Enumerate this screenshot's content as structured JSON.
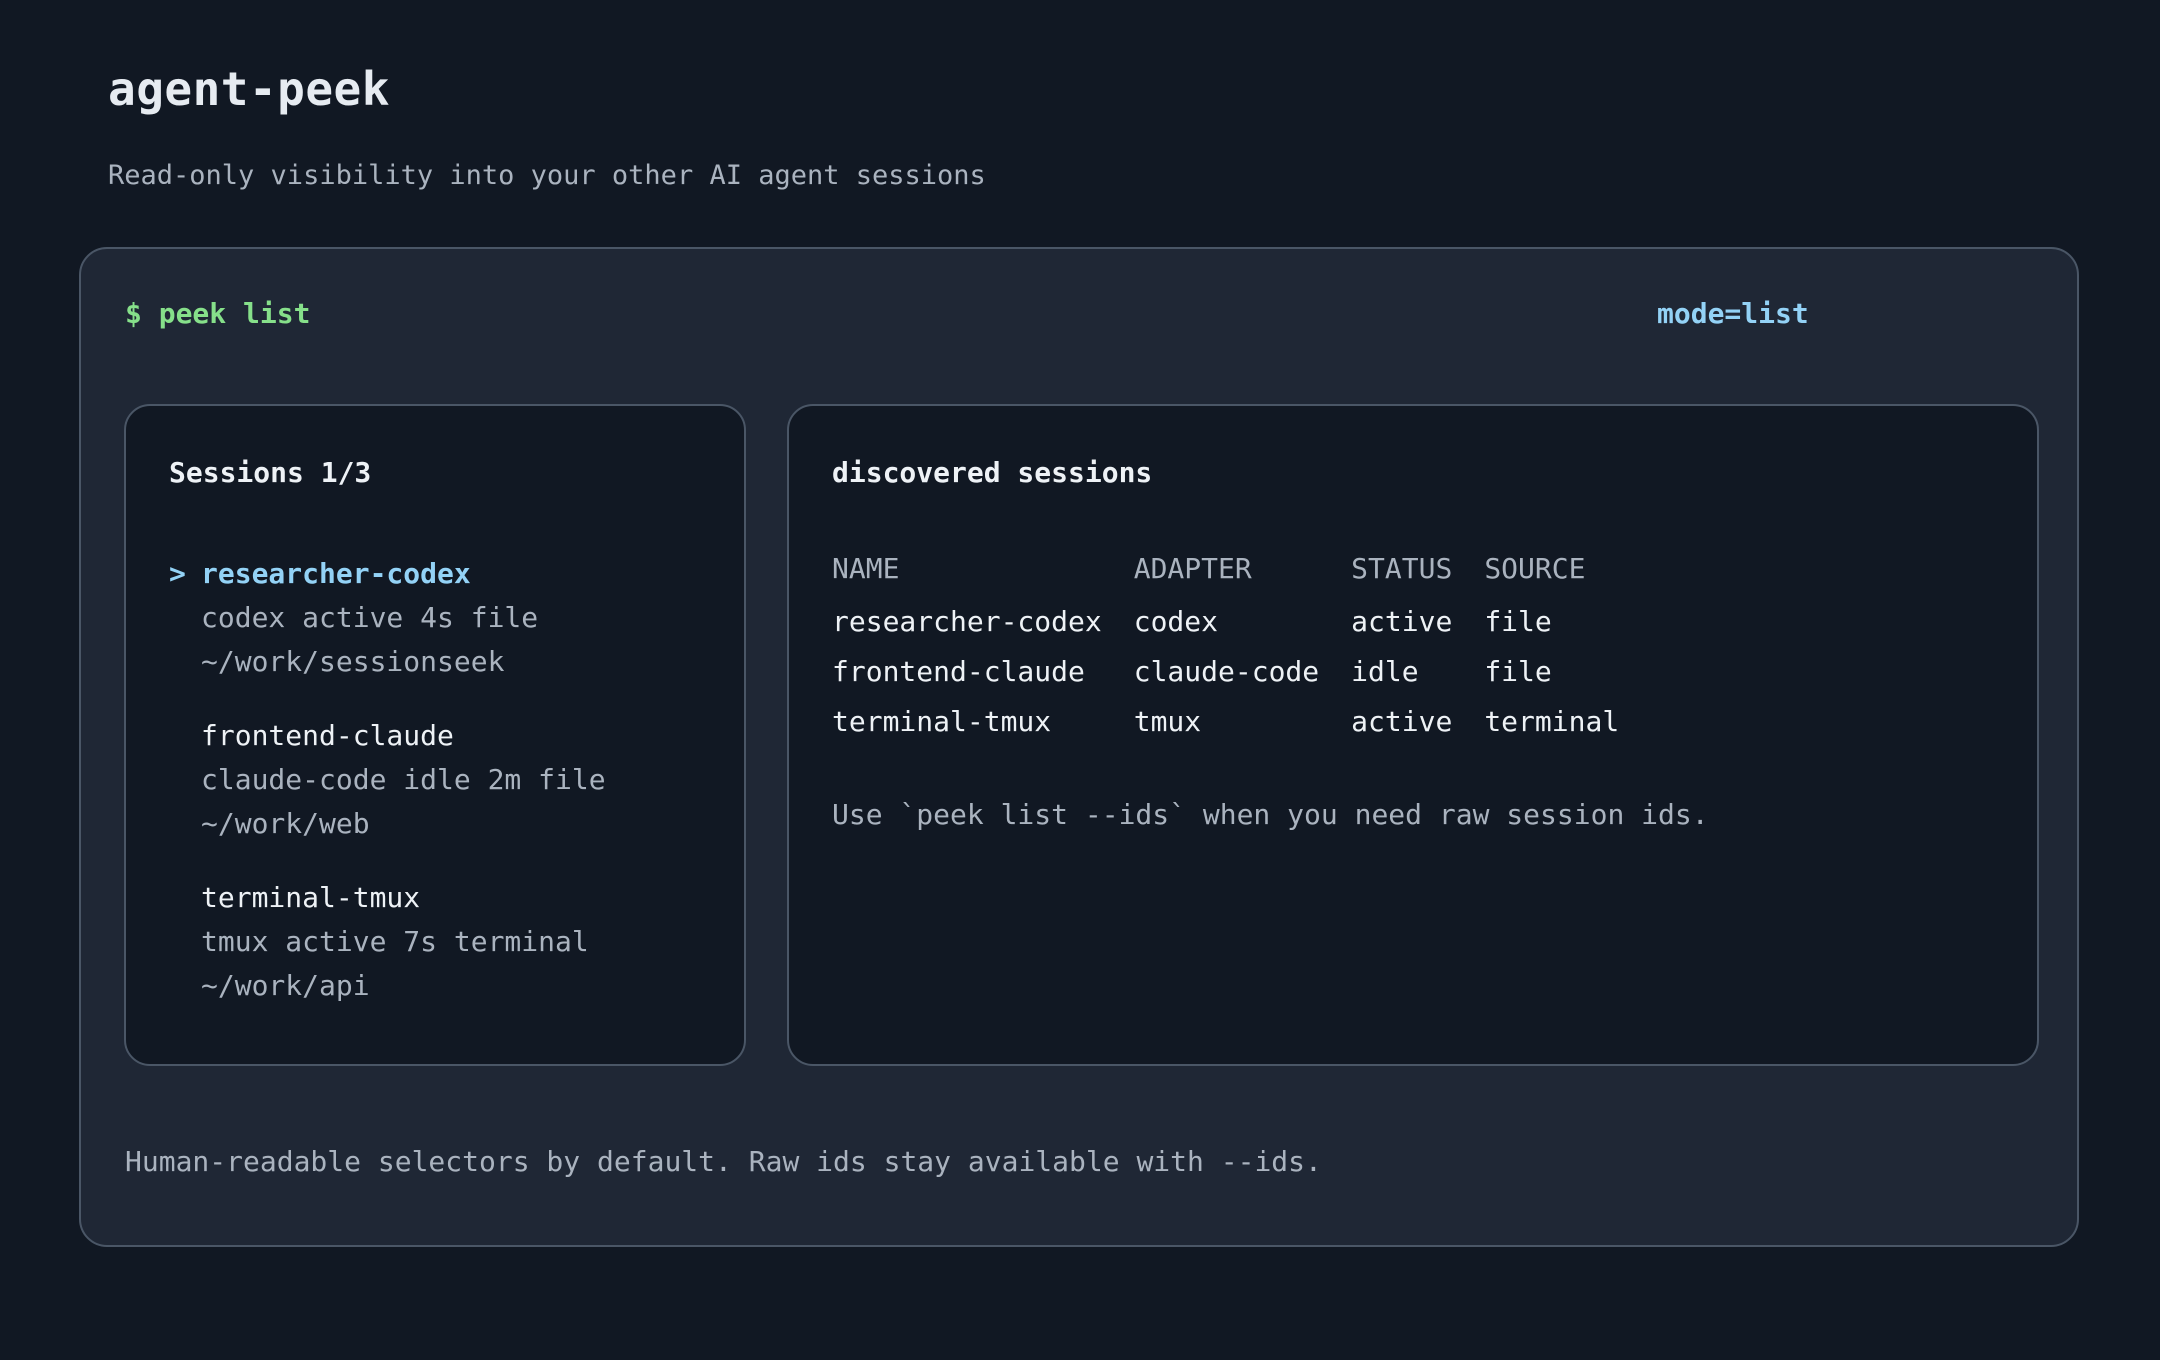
{
  "header": {
    "title": "agent-peek",
    "subtitle": "Read-only visibility into your other AI agent sessions"
  },
  "terminal": {
    "command": "$ peek list",
    "mode": "mode=list",
    "footer": "Human-readable selectors by default. Raw ids stay available with --ids."
  },
  "sessions_panel": {
    "title": "Sessions 1/3",
    "pointer": ">",
    "items": [
      {
        "name": "researcher-codex",
        "meta": "codex active 4s file",
        "path": "~/work/sessionseek",
        "selected": true
      },
      {
        "name": "frontend-claude",
        "meta": "claude-code idle 2m file",
        "path": "~/work/web",
        "selected": false
      },
      {
        "name": "terminal-tmux",
        "meta": "tmux active 7s terminal",
        "path": "~/work/api",
        "selected": false
      }
    ]
  },
  "discovered_panel": {
    "title": "discovered sessions",
    "columns": [
      "NAME",
      "ADAPTER",
      "STATUS",
      "SOURCE"
    ],
    "rows": [
      [
        "researcher-codex",
        "codex",
        "active",
        "file"
      ],
      [
        "frontend-claude",
        "claude-code",
        "idle",
        "file"
      ],
      [
        "terminal-tmux",
        "tmux",
        "active",
        "terminal"
      ]
    ],
    "hint": "Use `peek list --ids` when you need raw session ids."
  }
}
